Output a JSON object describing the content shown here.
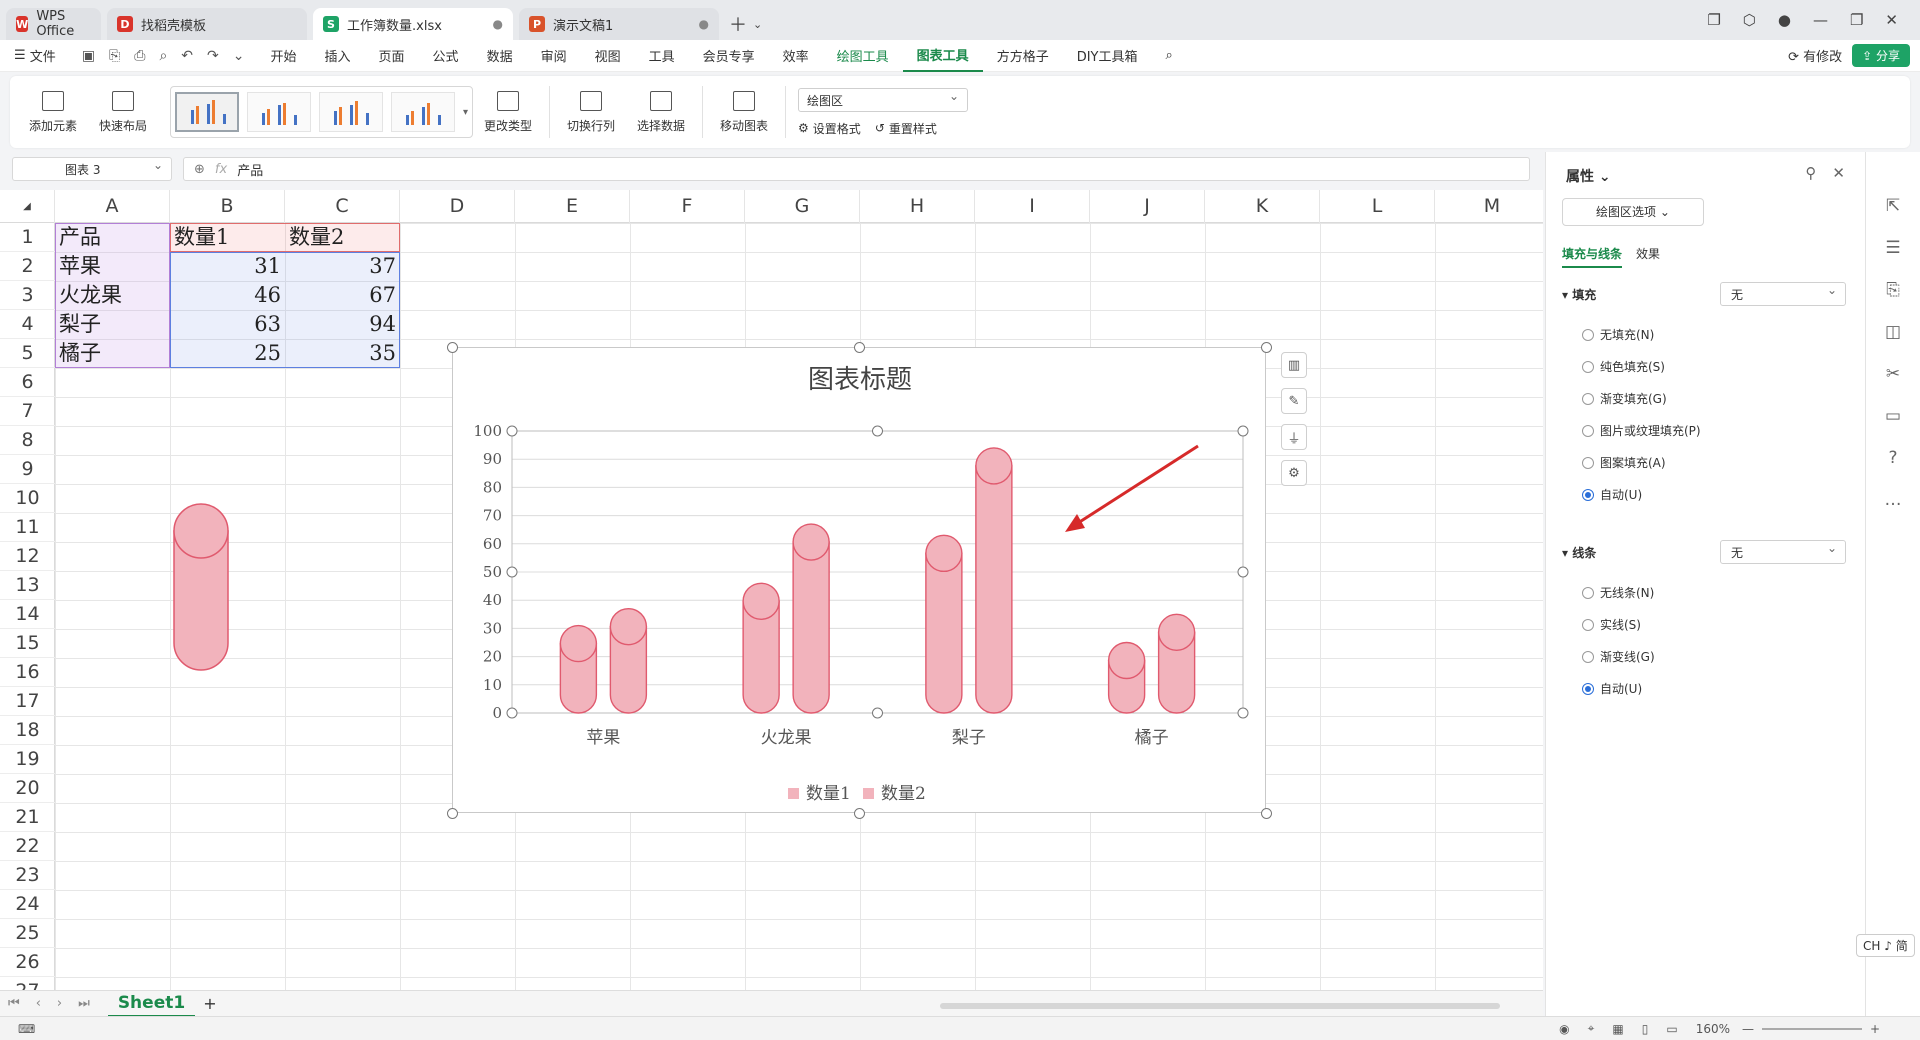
{
  "tabs": [
    {
      "label": "WPS Office",
      "color": "#d9342b",
      "glyph": "W"
    },
    {
      "label": "找稻壳模板",
      "color": "#d9342b",
      "glyph": "D"
    },
    {
      "label": "工作簿数量.xlsx",
      "color": "#1ea366",
      "glyph": "S"
    },
    {
      "label": "演示文稿1",
      "color": "#d9532b",
      "glyph": "P"
    }
  ],
  "menu": {
    "file": "文件",
    "items": [
      "开始",
      "插入",
      "页面",
      "公式",
      "数据",
      "审阅",
      "视图",
      "工具",
      "会员专享",
      "效率"
    ],
    "context": [
      "绘图工具",
      "图表工具"
    ],
    "extra": [
      "方方格子",
      "DIY工具箱"
    ],
    "changes": "有修改",
    "share": "分享"
  },
  "ribbon": {
    "add_element": "添加元素",
    "quick_layout": "快速布局",
    "change_type": "更改类型",
    "switch_rowcol": "切换行列",
    "select_data": "选择数据",
    "move_chart": "移动图表",
    "area_select": "绘图区",
    "set_format": "设置格式",
    "reset_style": "重置样式"
  },
  "namebox": "图表 3",
  "formula": "产品",
  "columns": [
    "A",
    "B",
    "C",
    "D",
    "E",
    "F",
    "G",
    "H",
    "I",
    "J",
    "K",
    "L",
    "M"
  ],
  "rows": [
    "1",
    "2",
    "3",
    "4",
    "5",
    "6",
    "7",
    "8",
    "9",
    "10",
    "11",
    "12",
    "13",
    "14",
    "15",
    "16",
    "17",
    "18",
    "19",
    "20",
    "21",
    "22",
    "23",
    "24",
    "25",
    "26",
    "27"
  ],
  "table": {
    "headers": [
      "产品",
      "数量1",
      "数量2"
    ],
    "rows": [
      [
        "苹果",
        "31",
        "37"
      ],
      [
        "火龙果",
        "46",
        "67"
      ],
      [
        "梨子",
        "63",
        "94"
      ],
      [
        "橘子",
        "25",
        "35"
      ]
    ]
  },
  "chart_data": {
    "type": "bar",
    "title": "图表标题",
    "categories": [
      "苹果",
      "火龙果",
      "梨子",
      "橘子"
    ],
    "series": [
      {
        "name": "数量1",
        "values": [
          31,
          46,
          63,
          25
        ]
      },
      {
        "name": "数量2",
        "values": [
          37,
          67,
          94,
          35
        ]
      }
    ],
    "ylim": [
      0,
      100
    ],
    "yticks": [
      0,
      10,
      20,
      30,
      40,
      50,
      60,
      70,
      80,
      90,
      100
    ],
    "legend": "bottom",
    "grid": true,
    "color": "#f2b3bc",
    "edge": "#e05a6e"
  },
  "sheet_tab": "Sheet1",
  "pane": {
    "title": "属性",
    "options_btn": "绘图区选项",
    "tab_fill": "填充与线条",
    "tab_effect": "效果",
    "fill_label": "填充",
    "fill_value": "无",
    "fill_options": [
      "无填充(N)",
      "纯色填充(S)",
      "渐变填充(G)",
      "图片或纹理填充(P)",
      "图案填充(A)",
      "自动(U)"
    ],
    "line_label": "线条",
    "line_value": "无",
    "line_options": [
      "无线条(N)",
      "实线(S)",
      "渐变线(G)",
      "自动(U)"
    ]
  },
  "status": {
    "zoom": "160%"
  },
  "ime": "CH ♪ 简"
}
